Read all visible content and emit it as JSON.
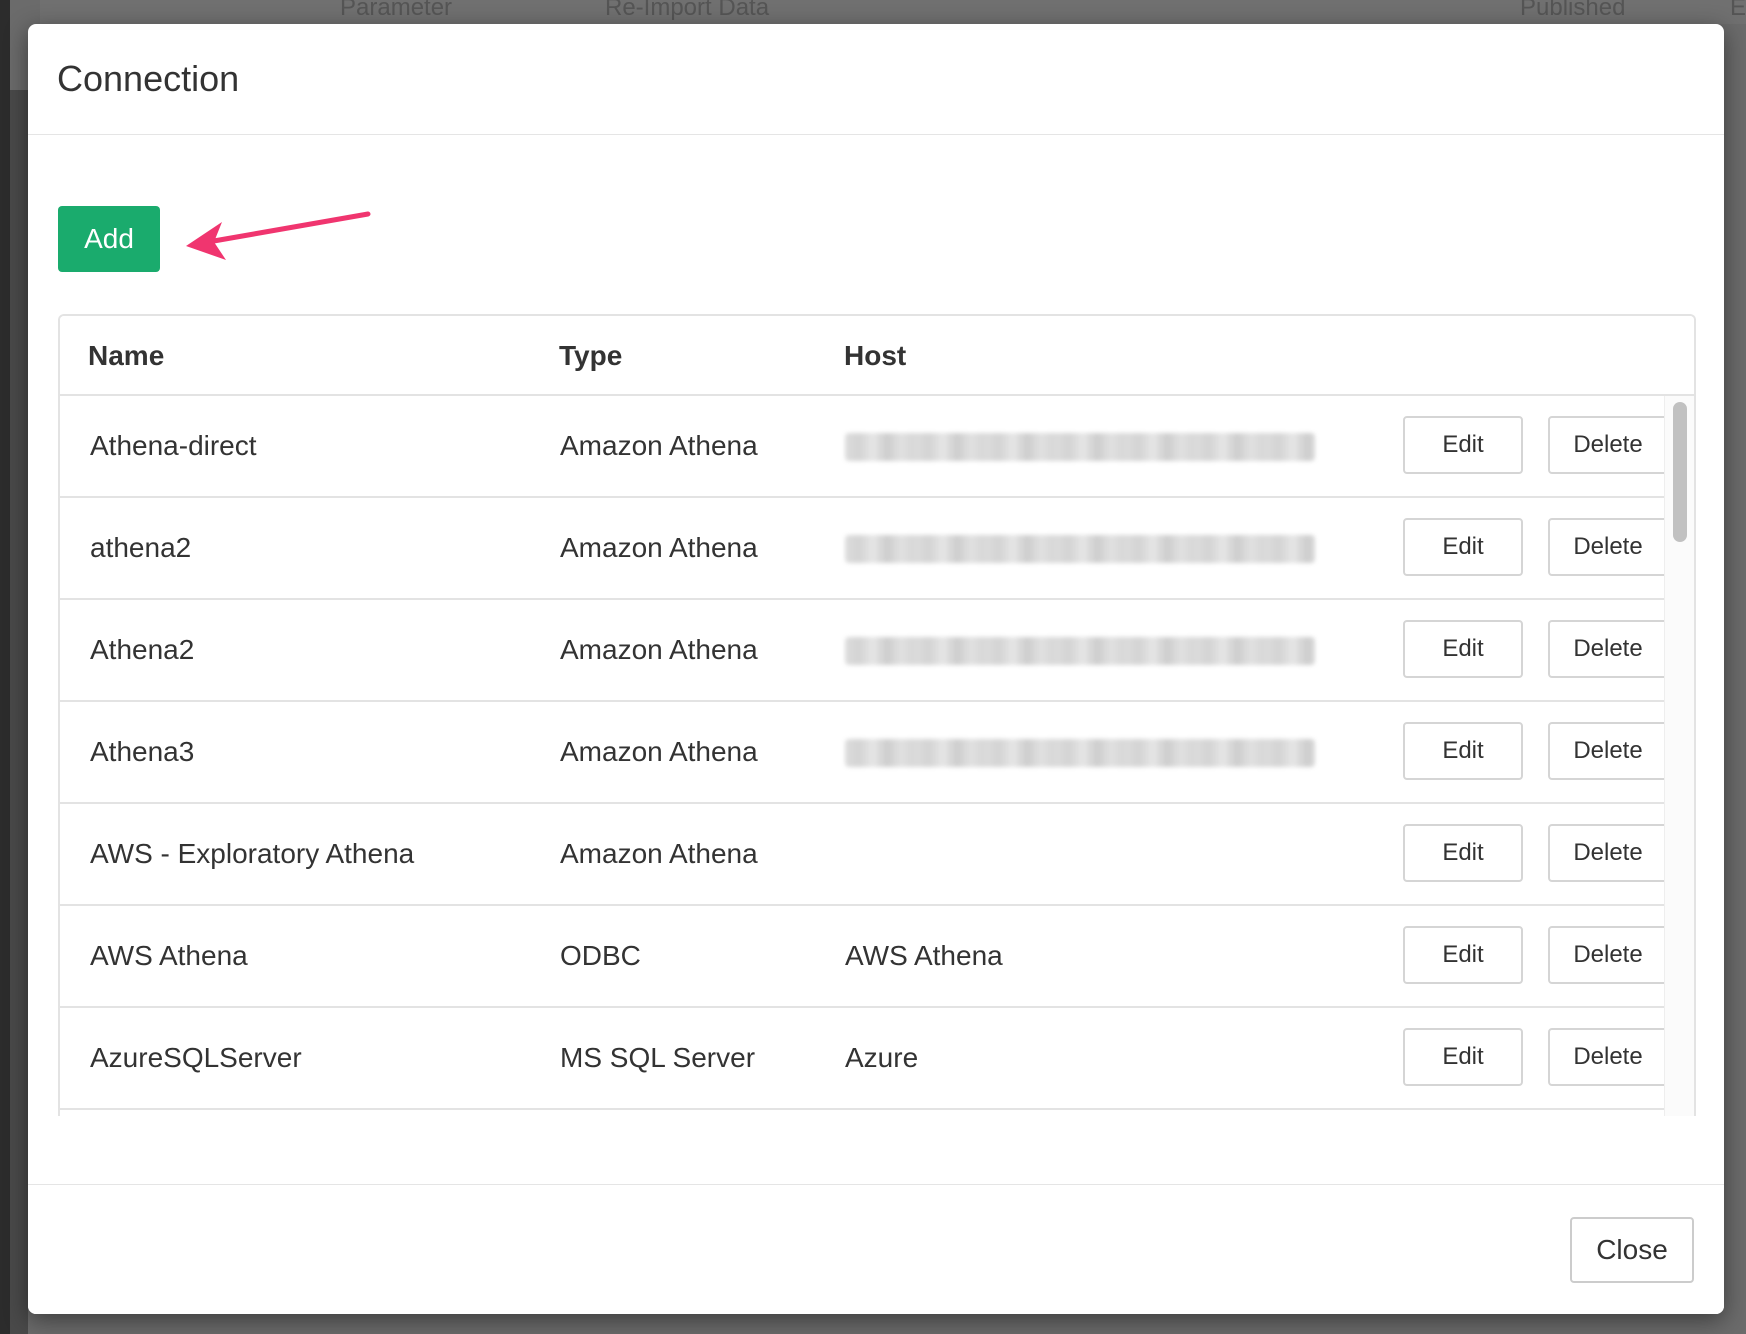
{
  "background": {
    "toolbar_items": [
      "Parameter",
      "Re-Import Data",
      "Published",
      "Exp"
    ]
  },
  "modal": {
    "title": "Connection",
    "add_label": "Add",
    "close_label": "Close",
    "accent_color": "#1aab6d",
    "annotation_color": "#f0356f"
  },
  "table": {
    "headers": {
      "name": "Name",
      "type": "Type",
      "host": "Host"
    },
    "edit_label": "Edit",
    "delete_label": "Delete",
    "rows": [
      {
        "name": "Athena-direct",
        "type": "Amazon Athena",
        "host": "",
        "host_obscured": true
      },
      {
        "name": "athena2",
        "type": "Amazon Athena",
        "host": "",
        "host_obscured": true
      },
      {
        "name": "Athena2",
        "type": "Amazon Athena",
        "host": "",
        "host_obscured": true
      },
      {
        "name": "Athena3",
        "type": "Amazon Athena",
        "host": "",
        "host_obscured": true
      },
      {
        "name": "AWS - Exploratory Athena",
        "type": "Amazon Athena",
        "host": "",
        "host_obscured": false
      },
      {
        "name": "AWS Athena",
        "type": "ODBC",
        "host": "AWS Athena",
        "host_obscured": false
      },
      {
        "name": "AzureSQLServer",
        "type": "MS SQL Server",
        "host": "Azure",
        "host_obscured": false
      }
    ]
  }
}
